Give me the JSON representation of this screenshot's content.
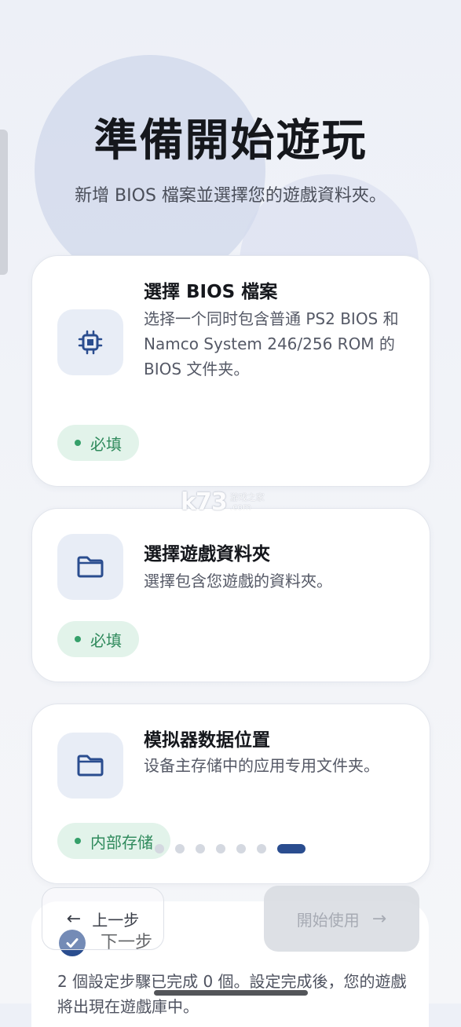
{
  "header": {
    "title": "準備開始遊玩",
    "subtitle": "新增 BIOS 檔案並選擇您的遊戲資料夾。"
  },
  "cards": [
    {
      "title": "選擇 BIOS 檔案",
      "description": "选择一个同时包含普通 PS2 BIOS 和 Namco System 246/256 ROM 的 BIOS 文件夹。",
      "icon": "chip-icon",
      "chip": "必填"
    },
    {
      "title": "選擇遊戲資料夾",
      "description": "選擇包含您遊戲的資料夾。",
      "icon": "folder-icon",
      "chip": "必填"
    },
    {
      "title": "模拟器数据位置",
      "description": "设备主存储中的应用专用文件夹。",
      "icon": "folder-icon",
      "chip": "内部存储"
    }
  ],
  "pager": {
    "count": 7,
    "active_index": 6
  },
  "nav": {
    "prev_label": "上一步",
    "start_label": "開始使用"
  },
  "sheet": {
    "next_label": "下一步",
    "summary": "2 個設定步驟已完成 0 個。設定完成後，您的遊戲將出現在遊戲庫中。"
  },
  "watermark": {
    "logo": "k73",
    "site": "游戏之家",
    "domain": ".com"
  },
  "colors": {
    "accent": "#2a4d8f",
    "chip_bg": "#e2f3ea",
    "chip_text": "#2f8a5c"
  }
}
